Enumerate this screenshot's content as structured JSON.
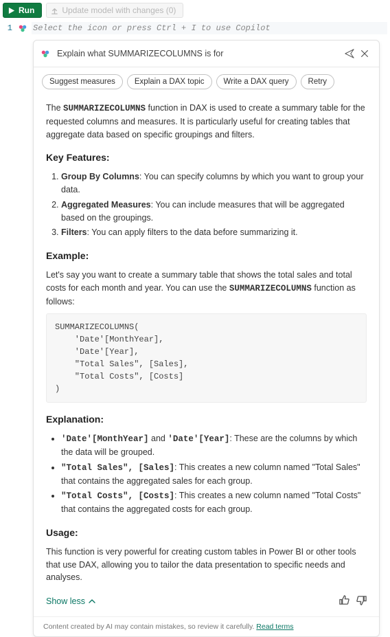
{
  "toolbar": {
    "run_label": "Run",
    "update_label": "Update model with changes (0)"
  },
  "editor": {
    "line_number": "1",
    "placeholder": "Select the icon or press Ctrl + I to use Copilot"
  },
  "copilot": {
    "header_title": "Explain what SUMMARIZECOLUMNS is for",
    "chips": {
      "suggest": "Suggest measures",
      "explain": "Explain a DAX topic",
      "write": "Write a DAX query",
      "retry": "Retry"
    },
    "intro_pre": "The ",
    "intro_func": "SUMMARIZECOLUMNS",
    "intro_post": " function in DAX is used to create a summary table for the requested columns and measures. It is particularly useful for creating tables that aggregate data based on specific groupings and filters.",
    "h_features": "Key Features:",
    "feat1_b": "Group By Columns",
    "feat1_t": ": You can specify columns by which you want to group your data.",
    "feat2_b": "Aggregated Measures",
    "feat2_t": ": You can include measures that will be aggregated based on the groupings.",
    "feat3_b": "Filters",
    "feat3_t": ": You can apply filters to the data before summarizing it.",
    "h_example": "Example:",
    "example_pre": "Let's say you want to create a summary table that shows the total sales and total costs for each month and year. You can use the ",
    "example_func": "SUMMARIZECOLUMNS",
    "example_post": " function as follows:",
    "code": "SUMMARIZECOLUMNS(\n    'Date'[MonthYear],\n    'Date'[Year],\n    \"Total Sales\", [Sales],\n    \"Total Costs\", [Costs]\n)",
    "h_expl": "Explanation:",
    "expl1_c": "'Date'[MonthYear]",
    "expl1_mid": " and ",
    "expl1_c2": "'Date'[Year]",
    "expl1_t": ": These are the columns by which the data will be grouped.",
    "expl2_c": "\"Total Sales\", [Sales]",
    "expl2_t": ": This creates a new column named \"Total Sales\" that contains the aggregated sales for each group.",
    "expl3_c": "\"Total Costs\", [Costs]",
    "expl3_t": ": This creates a new column named \"Total Costs\" that contains the aggregated costs for each group.",
    "h_usage": "Usage:",
    "usage_text": "This function is very powerful for creating custom tables in Power BI or other tools that use DAX, allowing you to tailor the data presentation to specific needs and analyses.",
    "show_less": "Show less",
    "footer_text": "Content created by AI may contain mistakes, so review it carefully. ",
    "footer_link": "Read terms"
  }
}
